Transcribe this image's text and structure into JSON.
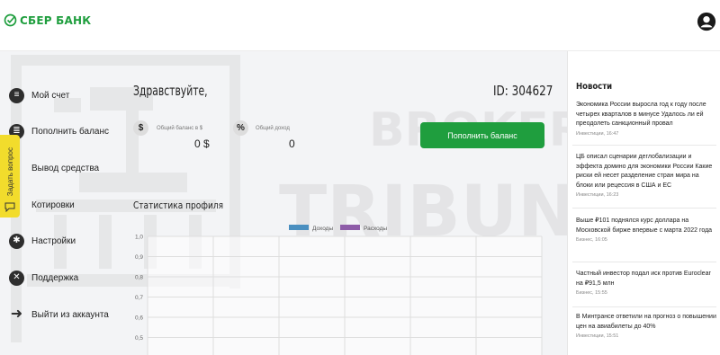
{
  "header": {
    "brand": "СБЕР БАНК",
    "logo_icon": "sber-check-icon",
    "profile_icon": "user-avatar-icon",
    "brand_color": "#1f9e3e"
  },
  "sidebar": {
    "items": [
      {
        "label": "Мой счет",
        "icon": "database-icon"
      },
      {
        "label": "Пополнить баланс",
        "icon": "stack-icon"
      },
      {
        "label": "Вывод средства",
        "icon": "withdraw-icon"
      },
      {
        "label": "Котировки",
        "icon": "quotes-icon"
      },
      {
        "label": "Настройки",
        "icon": "gear-icon"
      },
      {
        "label": "Поддержка",
        "icon": "lifebuoy-icon"
      },
      {
        "label": "Выйти из аккаунта",
        "icon": "logout-icon"
      }
    ]
  },
  "ask_question": {
    "label": "Задать вопрос",
    "icon": "chat-icon",
    "color": "#f2dc2c"
  },
  "main": {
    "greeting": "Здравствуйте,",
    "user_id": "ID: 304627",
    "balance": {
      "symbol": "$",
      "label": "Общий баланс в $",
      "value": "0 $"
    },
    "income": {
      "symbol": "%",
      "label": "Общий доход",
      "value": "0"
    },
    "topup_button": "Пополнить баланс",
    "stats_title": "Статистика профиля"
  },
  "watermark": {
    "line1": "BROKER",
    "line2": "TRIBUNAL"
  },
  "chart_data": {
    "type": "bar",
    "series": [
      {
        "name": "Доходы",
        "color": "#4a8fc0",
        "values": []
      },
      {
        "name": "Расходы",
        "color": "#8e5ca8",
        "values": []
      }
    ],
    "yticks": [
      "1,0",
      "0,9",
      "0,8",
      "0,7",
      "0,6",
      "0,5"
    ],
    "ylim": [
      0,
      1
    ],
    "grid": true,
    "legend": "top-center"
  },
  "news": {
    "title": "Новости",
    "items": [
      {
        "title": "Экономика России выросла год к году после четырех кварталов в минусе Удалось ли ей преодолеть санкционный провал",
        "meta": "Инвестиции, 16:47"
      },
      {
        "title": "ЦБ описал сценарии деглобализации и эффекта домино для экономики России Какие риски ей несет разделение стран мира на блоки или рецессия в США и ЕС",
        "meta": "Инвестиции, 16:23"
      },
      {
        "title": "Выше ₽101 поднялся курс доллара на Московской бирже впервые с марта 2022 года",
        "meta": "Бизнес, 16:05"
      },
      {
        "title": "Частный инвестор подал иск против Euroclear на ₽91,5 млн",
        "meta": "Бизнес, 15:55"
      },
      {
        "title": "В Минтрансе ответили на прогноз о повышении цен на авиабилеты до 40%",
        "meta": "Инвестиции, 15:51"
      }
    ]
  }
}
